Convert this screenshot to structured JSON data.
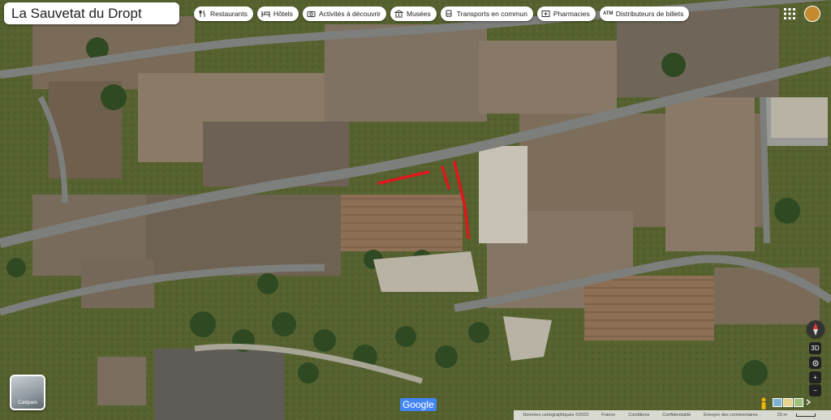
{
  "search": {
    "title": "La Sauvetat du Dropt"
  },
  "categories": [
    {
      "label": "Restaurants",
      "icon": "restaurant-icon"
    },
    {
      "label": "Hôtels",
      "icon": "hotel-icon"
    },
    {
      "label": "Activités à découvrir",
      "icon": "camera-icon"
    },
    {
      "label": "Musées",
      "icon": "museum-icon"
    },
    {
      "label": "Transports en commun",
      "icon": "transit-icon"
    },
    {
      "label": "Pharmacies",
      "icon": "pharmacy-icon"
    },
    {
      "label": "Distributeurs de billets",
      "icon": "atm-icon"
    }
  ],
  "layers": {
    "label": "Calques"
  },
  "logo": {
    "text": "Google"
  },
  "footer": {
    "copyright": "Données cartographiques ©2023",
    "country": "France",
    "terms": "Conditions",
    "privacy": "Confidentialité",
    "feedback": "Envoyer des commentaires",
    "scale": "20 m"
  },
  "controls": {
    "tilt": "3D",
    "zoom_in": "+",
    "zoom_out": "−"
  },
  "colors": {
    "route": "#e0161b",
    "road": "#7d7f7c",
    "chip_bg": "#ffffff"
  }
}
